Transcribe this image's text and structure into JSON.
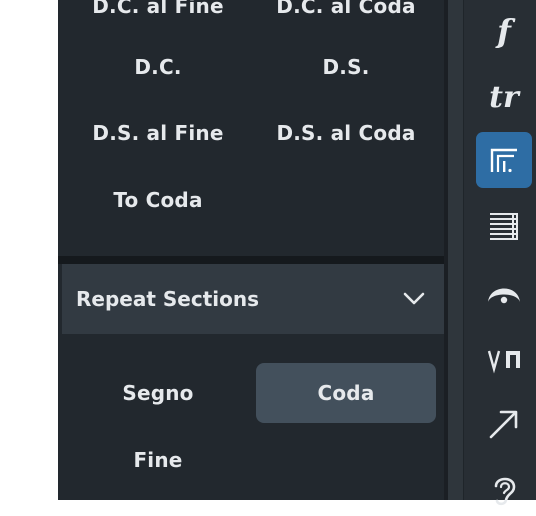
{
  "panel": {
    "items_top": [
      "D.C. al Fine",
      "D.C. al Coda",
      "D.C.",
      "D.S.",
      "D.S. al Fine",
      "D.S. al Coda",
      "To Coda"
    ],
    "section": {
      "title": "Repeat Sections",
      "items": [
        "Segno",
        "Coda",
        "Fine"
      ],
      "selected": "Coda"
    }
  },
  "toolbar": {
    "icons": [
      "dynamics-f-icon",
      "trill-icon",
      "repeat-ending-icon",
      "tablature-icon",
      "fermata-icon",
      "bowing-icon",
      "arrow-icon",
      "ear-icon"
    ],
    "active": "repeat-ending-icon"
  },
  "colors": {
    "panel_bg": "#22282e",
    "section_header_bg": "#323a42",
    "selected_bg": "#43505c",
    "active_tool_bg": "#2e6da4",
    "text": "#e6e9ec"
  }
}
